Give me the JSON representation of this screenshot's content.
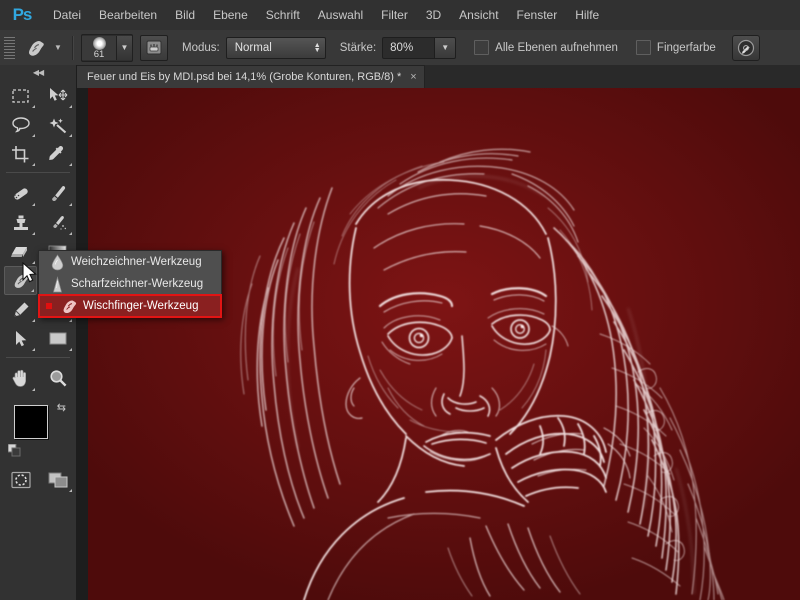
{
  "app": {
    "name": "Ps",
    "logo_color": "#31a8e0"
  },
  "menubar": {
    "items": [
      {
        "label": "Datei"
      },
      {
        "label": "Bearbeiten"
      },
      {
        "label": "Bild"
      },
      {
        "label": "Ebene"
      },
      {
        "label": "Schrift"
      },
      {
        "label": "Auswahl"
      },
      {
        "label": "Filter"
      },
      {
        "label": "3D"
      },
      {
        "label": "Ansicht"
      },
      {
        "label": "Fenster"
      },
      {
        "label": "Hilfe"
      }
    ]
  },
  "options_bar": {
    "tool_icon": "smudge-tool-icon",
    "brush_size": "61",
    "brush_panel_icon": "brush-panel-toggle-icon",
    "mode_label": "Modus:",
    "mode_value": "Normal",
    "strength_label": "Stärke:",
    "strength_value": "80%",
    "sample_all_layers_label": "Alle Ebenen aufnehmen",
    "finger_paint_label": "Fingerfarbe",
    "pressure_icon": "tablet-pressure-size-icon"
  },
  "tabbar": {
    "document_title": "Feuer und Eis by MDI.psd bei 14,1% (Grobe Konturen, RGB/8) *",
    "close_glyph": "×"
  },
  "toolbar": {
    "collapse_glyph": "◀◀",
    "groups": [
      {
        "tools": [
          {
            "name": "rectangular-marquee-tool",
            "has_corner": true
          },
          {
            "name": "move-tool",
            "has_corner": true
          },
          {
            "name": "lasso-tool",
            "has_corner": true
          },
          {
            "name": "magic-wand-tool",
            "has_corner": true
          },
          {
            "name": "crop-tool",
            "has_corner": true
          },
          {
            "name": "eyedropper-tool",
            "has_corner": true
          }
        ]
      },
      {
        "tools": [
          {
            "name": "spot-healing-brush-tool",
            "has_corner": true
          },
          {
            "name": "brush-tool",
            "has_corner": true
          },
          {
            "name": "clone-stamp-tool",
            "has_corner": true
          },
          {
            "name": "history-brush-tool",
            "has_corner": true
          },
          {
            "name": "eraser-tool",
            "has_corner": true
          },
          {
            "name": "gradient-tool",
            "has_corner": true
          },
          {
            "name": "smudge-tool",
            "has_corner": true,
            "active": true
          },
          {
            "name": "dodge-tool",
            "has_corner": true
          },
          {
            "name": "pen-tool",
            "has_corner": true
          },
          {
            "name": "horizontal-type-tool",
            "has_corner": true
          },
          {
            "name": "path-selection-tool",
            "has_corner": true
          },
          {
            "name": "rectangle-tool",
            "has_corner": true
          }
        ]
      },
      {
        "tools": [
          {
            "name": "hand-tool",
            "has_corner": true
          },
          {
            "name": "zoom-tool",
            "has_corner": false
          }
        ]
      }
    ],
    "foreground_color": "#000000",
    "background_color": "#ffffff",
    "swap_icon": "swap-colors-icon",
    "default_colors_icon": "default-colors-icon",
    "quick_mask_icon": "quick-mask-icon",
    "screen_mode_icon": "screen-mode-icon"
  },
  "flyout": {
    "items": [
      {
        "label": "Weichzeichner-Werkzeug",
        "icon": "blur-droplet-icon",
        "selected": false
      },
      {
        "label": "Scharfzeichner-Werkzeug",
        "icon": "sharpen-cone-icon",
        "selected": false
      },
      {
        "label": "Wischfinger-Werkzeug",
        "icon": "smudge-finger-icon",
        "selected": true
      }
    ],
    "highlight_border_color": "#e21414",
    "highlight_fill_color": "#8a2020"
  },
  "canvas": {
    "background_color": "#5a0d0d",
    "artwork_description": "glowing-edges-portrait"
  },
  "cursor": {
    "icon": "mouse-pointer-icon"
  }
}
